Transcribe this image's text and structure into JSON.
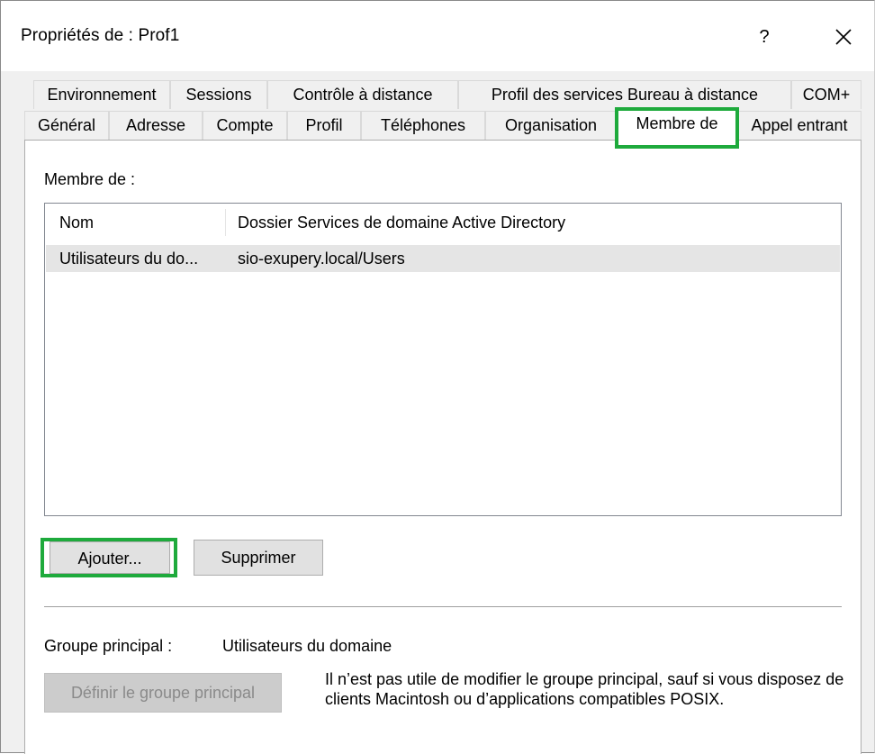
{
  "window": {
    "title": "Propriétés de : Prof1",
    "help_label": "?"
  },
  "tabs": {
    "row1": [
      "Environnement",
      "Sessions",
      "Contrôle à distance",
      "Profil des services Bureau à distance",
      "COM+"
    ],
    "row2": [
      "Général",
      "Adresse",
      "Compte",
      "Profil",
      "Téléphones",
      "Organisation",
      "Membre de",
      "Appel entrant"
    ],
    "active": "Membre de"
  },
  "member_of": {
    "section_label": "Membre de :",
    "columns": [
      "Nom",
      "Dossier Services de domaine Active Directory"
    ],
    "rows": [
      [
        "Utilisateurs du do...",
        "sio-exupery.local/Users"
      ]
    ]
  },
  "buttons": {
    "add": "Ajouter...",
    "remove": "Supprimer",
    "set_primary": "Définir le groupe principal"
  },
  "primary_group": {
    "label": "Groupe principal :",
    "value": "Utilisateurs du domaine",
    "description": "Il n’est pas utile de modifier le groupe principal, sauf si vous disposez de clients Macintosh ou d’applications compatibles POSIX."
  },
  "colors": {
    "highlight": "#1eaa3c",
    "dialog_background": "#f0f0f0",
    "selected_row": "#e5e5e5"
  }
}
